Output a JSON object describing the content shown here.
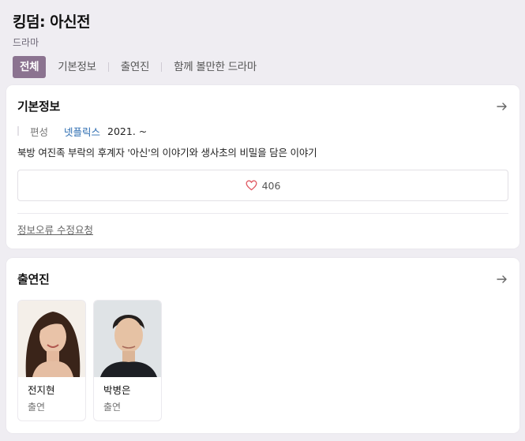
{
  "header": {
    "title": "킹덤: 아신전",
    "genre": "드라마"
  },
  "tabs": [
    {
      "label": "전체",
      "active": true
    },
    {
      "label": "기본정보",
      "active": false
    },
    {
      "label": "출연진",
      "active": false
    },
    {
      "label": "함께 볼만한 드라마",
      "active": false
    }
  ],
  "info": {
    "section_title": "기본정보",
    "meta_label": "편성",
    "channel": "넷플릭스",
    "date": "2021. ~",
    "description": "북방 여진족 부락의 후계자 '아신'의 이야기와 생사초의 비밀을 담은 이야기",
    "likes": "406",
    "report_link": "정보오류 수정요청"
  },
  "cast": {
    "section_title": "출연진",
    "members": [
      {
        "name": "전지현",
        "role": "출연"
      },
      {
        "name": "박병은",
        "role": "출연"
      }
    ]
  },
  "colors": {
    "active_tab": "#8b7390",
    "link": "#2a6bb0",
    "heart": "#e05a63",
    "background": "#efedf2"
  },
  "icons": {
    "arrow": "arrow-right-icon",
    "heart": "heart-outline-icon"
  }
}
